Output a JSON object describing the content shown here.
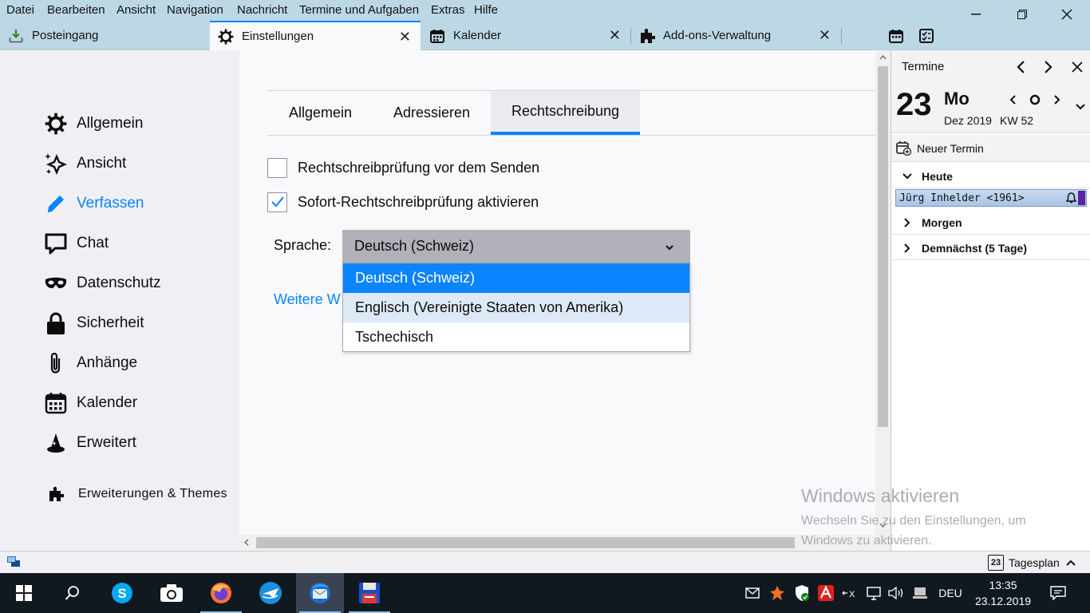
{
  "menubar": {
    "items": [
      "Datei",
      "Bearbeiten",
      "Ansicht",
      "Navigation",
      "Nachricht",
      "Termine und Aufgaben",
      "Extras",
      "Hilfe"
    ]
  },
  "tabs": [
    {
      "label": "Posteingang",
      "icon": "inbox-download-icon"
    },
    {
      "label": "Einstellungen",
      "icon": "gear-icon"
    },
    {
      "label": "Kalender",
      "icon": "calendar-icon"
    },
    {
      "label": "Add-ons-Verwaltung",
      "icon": "puzzle-icon"
    }
  ],
  "sidebar": {
    "categories": [
      {
        "label": "Allgemein",
        "icon": "gear-icon"
      },
      {
        "label": "Ansicht",
        "icon": "sparkle-icon"
      },
      {
        "label": "Verfassen",
        "icon": "pencil-icon"
      },
      {
        "label": "Chat",
        "icon": "chat-bubble-icon"
      },
      {
        "label": "Datenschutz",
        "icon": "mask-icon"
      },
      {
        "label": "Sicherheit",
        "icon": "lock-icon"
      },
      {
        "label": "Anhänge",
        "icon": "paperclip-icon"
      },
      {
        "label": "Kalender",
        "icon": "calendar-icon"
      },
      {
        "label": "Erweitert",
        "icon": "wizard-hat-icon"
      }
    ],
    "active": "Verfassen",
    "extensions_label": "Erweiterungen & Themes"
  },
  "main": {
    "subtabs": [
      "Allgemein",
      "Adressieren",
      "Rechtschreibung"
    ],
    "selected_subtab": "Rechtschreibung",
    "check_before_send": {
      "label": "Rechtschreibprüfung vor dem Senden",
      "checked": false
    },
    "check_as_you_type": {
      "label": "Sofort-Rechtschreibprüfung aktivieren",
      "checked": true
    },
    "language_label": "Sprache:",
    "language_value": "Deutsch (Schweiz)",
    "language_options": [
      "Deutsch (Schweiz)",
      "Englisch (Vereinigte Staaten von Amerika)",
      "Tschechisch"
    ],
    "more_link": "Weitere W"
  },
  "today_pane": {
    "title": "Termine",
    "day_number": "23",
    "day_name": "Mo",
    "month_year": "Dez 2019",
    "week": "KW 52",
    "new_event": "Neuer Termin",
    "sections": [
      "Heute",
      "Morgen",
      "Demnächst (5 Tage)"
    ],
    "event": "Jürg Inhelder <1961>"
  },
  "watermark": {
    "title": "Windows aktivieren",
    "line1": "Wechseln Sie zu den Einstellungen, um",
    "line2": "Windows zu aktivieren."
  },
  "statusbar": {
    "tagesplan": "Tagesplan",
    "tagesplan_day": "23"
  },
  "taskbar": {
    "language": "DEU",
    "time": "13:35",
    "date": "23.12.2019"
  },
  "colors": {
    "accent": "#0a84ff",
    "titlebar": "#bcd8e4",
    "taskbar": "#101820"
  }
}
